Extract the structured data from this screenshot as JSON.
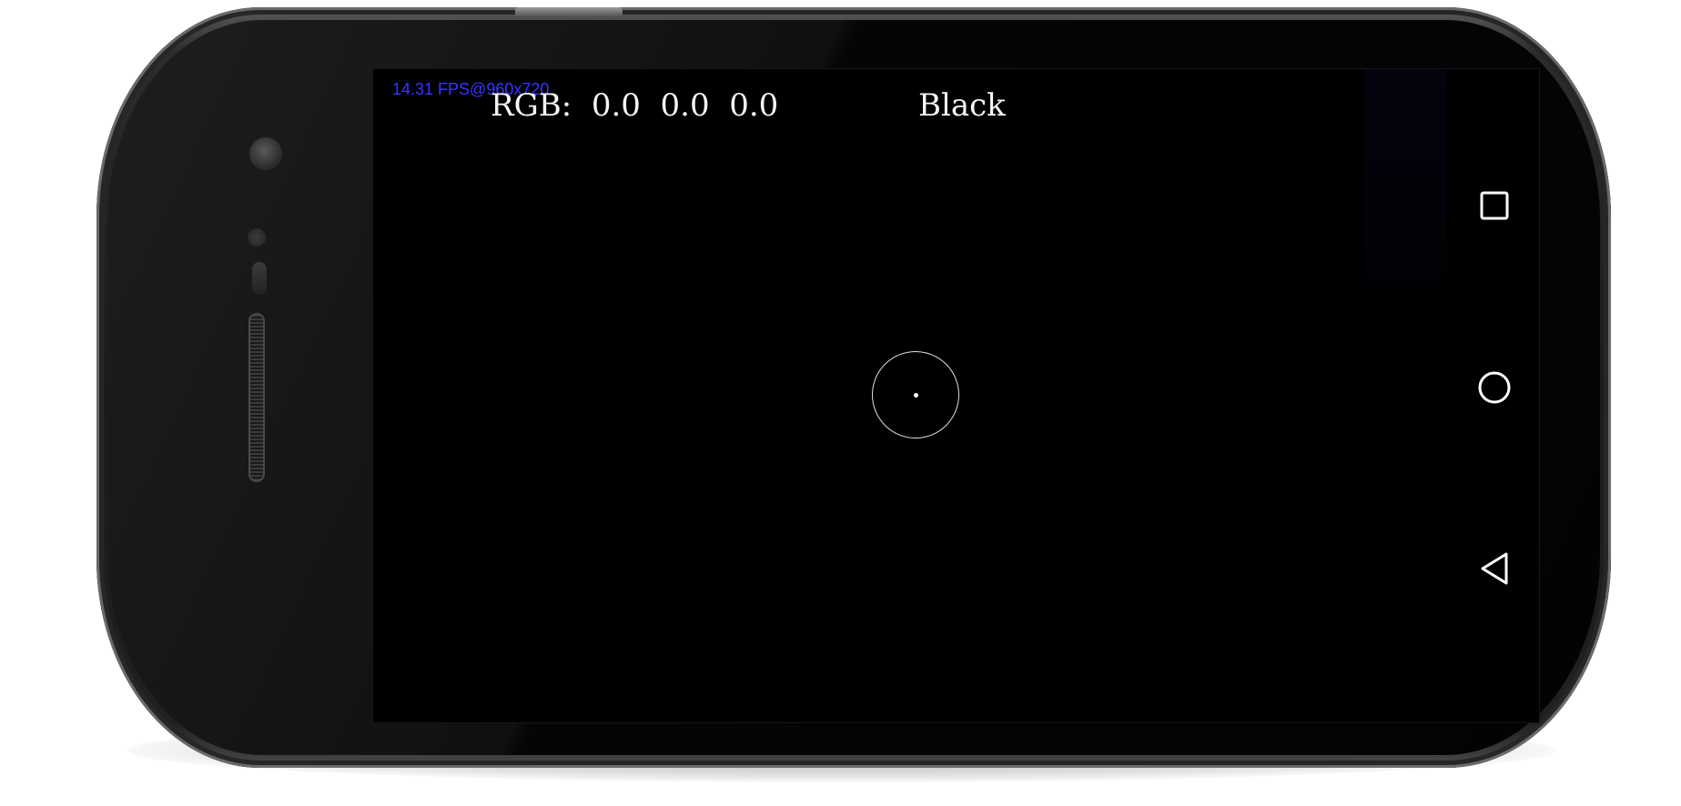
{
  "overlay": {
    "fps_text": "14.31 FPS@960x720",
    "rgb_text": "RGB:  0.0  0.0  0.0",
    "color_name": "Black"
  },
  "nav_bar": {
    "icons": [
      "recents-square-icon",
      "home-circle-icon",
      "back-triangle-icon"
    ]
  },
  "colors": {
    "fps_text": "#3a35ff",
    "overlay_text": "#f5f5f5",
    "screen_background": "#000000"
  }
}
